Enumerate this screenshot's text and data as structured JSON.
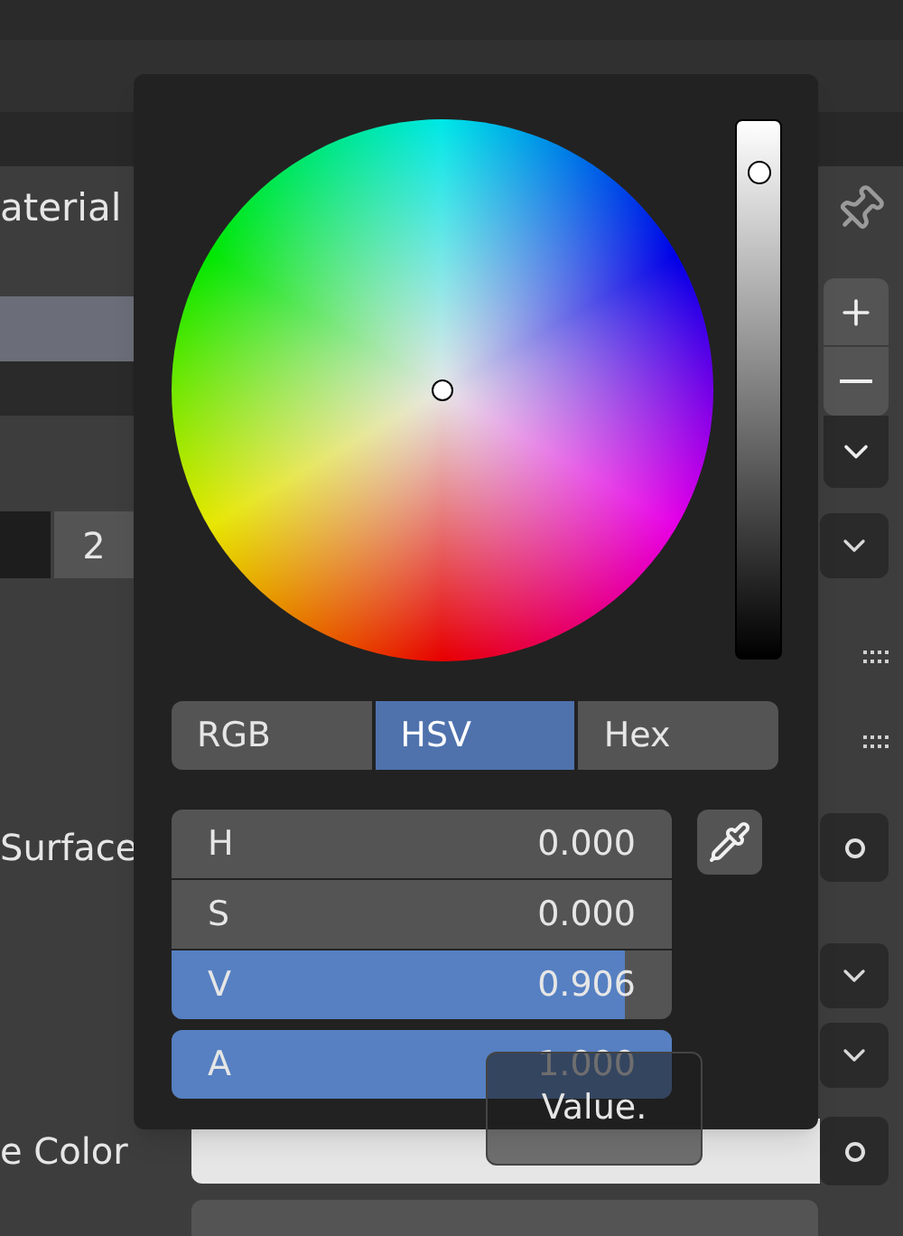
{
  "panel": {
    "material_label": "aterial",
    "slot_count": "2",
    "surface_label": "Surface",
    "color_label": "e Color"
  },
  "color_picker": {
    "value_slider": {
      "level": 0.906
    },
    "modes": [
      {
        "label": "RGB",
        "selected": false
      },
      {
        "label": "HSV",
        "selected": true
      },
      {
        "label": "Hex",
        "selected": false
      }
    ],
    "fields": [
      {
        "label": "H",
        "value": "0.000",
        "level": 0
      },
      {
        "label": "S",
        "value": "0.000",
        "level": 0
      },
      {
        "label": "V",
        "value": "0.906",
        "level": 0.906
      },
      {
        "label": "A",
        "value": "1.000",
        "level": 1
      }
    ],
    "tooltip": "Value."
  }
}
